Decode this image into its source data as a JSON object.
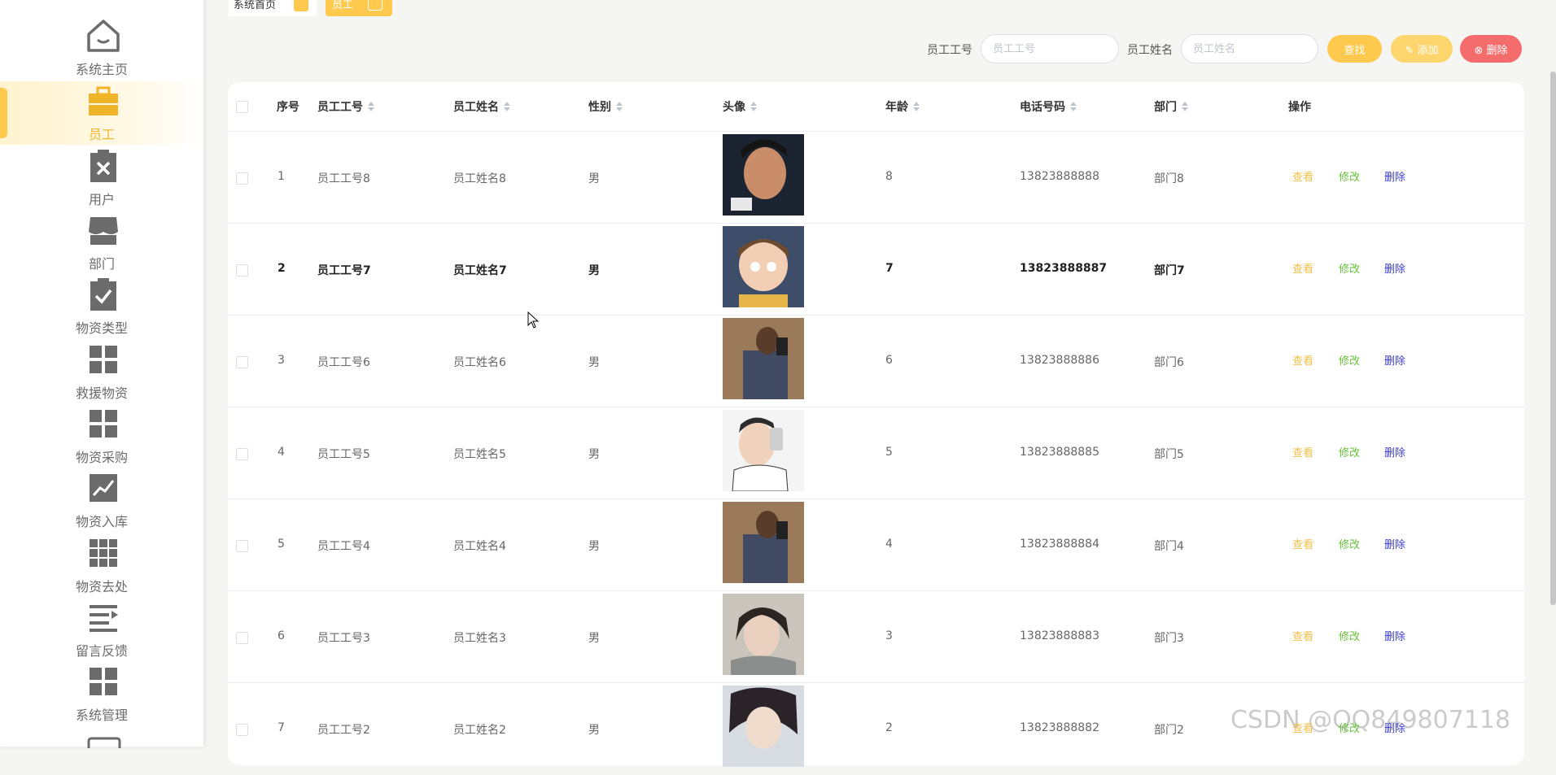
{
  "sidebar": {
    "items": [
      {
        "label": "系统主页",
        "icon": "home-icon"
      },
      {
        "label": "员工",
        "icon": "briefcase-icon",
        "active": true
      },
      {
        "label": "用户",
        "icon": "clipboard-x-icon"
      },
      {
        "label": "部门",
        "icon": "store-icon"
      },
      {
        "label": "物资类型",
        "icon": "clipboard-check-icon"
      },
      {
        "label": "救援物资",
        "icon": "grid-icon"
      },
      {
        "label": "物资采购",
        "icon": "grid-icon"
      },
      {
        "label": "物资入库",
        "icon": "trend-chart-icon"
      },
      {
        "label": "物资去处",
        "icon": "grid-nine-icon"
      },
      {
        "label": "留言反馈",
        "icon": "list-icon"
      },
      {
        "label": "系统管理",
        "icon": "grid-icon"
      }
    ]
  },
  "tabs": {
    "home": "系统首页",
    "current": "员工"
  },
  "search": {
    "emp_no_label": "员工工号",
    "emp_no_placeholder": "员工工号",
    "emp_name_label": "员工姓名",
    "emp_name_placeholder": "员工姓名",
    "search_button": "查找",
    "add_button": "添加",
    "delete_button": "删除"
  },
  "table": {
    "columns": {
      "index": "序号",
      "emp_no": "员工工号",
      "emp_name": "员工姓名",
      "gender": "性别",
      "avatar": "头像",
      "age": "年龄",
      "phone": "电话号码",
      "dept": "部门",
      "ops": "操作"
    },
    "actions": {
      "view": "查看",
      "edit": "修改",
      "delete": "删除"
    },
    "rows": [
      {
        "index": "1",
        "emp_no": "员工工号8",
        "emp_name": "员工姓名8",
        "gender": "男",
        "age": "8",
        "phone": "13823888888",
        "dept": "部门8"
      },
      {
        "index": "2",
        "emp_no": "员工工号7",
        "emp_name": "员工姓名7",
        "gender": "男",
        "age": "7",
        "phone": "13823888887",
        "dept": "部门7"
      },
      {
        "index": "3",
        "emp_no": "员工工号6",
        "emp_name": "员工姓名6",
        "gender": "男",
        "age": "6",
        "phone": "13823888886",
        "dept": "部门6"
      },
      {
        "index": "4",
        "emp_no": "员工工号5",
        "emp_name": "员工姓名5",
        "gender": "男",
        "age": "5",
        "phone": "13823888885",
        "dept": "部门5"
      },
      {
        "index": "5",
        "emp_no": "员工工号4",
        "emp_name": "员工姓名4",
        "gender": "男",
        "age": "4",
        "phone": "13823888884",
        "dept": "部门4"
      },
      {
        "index": "6",
        "emp_no": "员工工号3",
        "emp_name": "员工姓名3",
        "gender": "男",
        "age": "3",
        "phone": "13823888883",
        "dept": "部门3"
      },
      {
        "index": "7",
        "emp_no": "员工工号2",
        "emp_name": "员工姓名2",
        "gender": "男",
        "age": "2",
        "phone": "13823888882",
        "dept": "部门2"
      }
    ]
  },
  "watermark": "CSDN @QQ849807118",
  "colors": {
    "accent": "#ffc94d",
    "danger": "#f56c6c",
    "edit": "#67c23a",
    "delete_link": "#3b3bd6"
  }
}
